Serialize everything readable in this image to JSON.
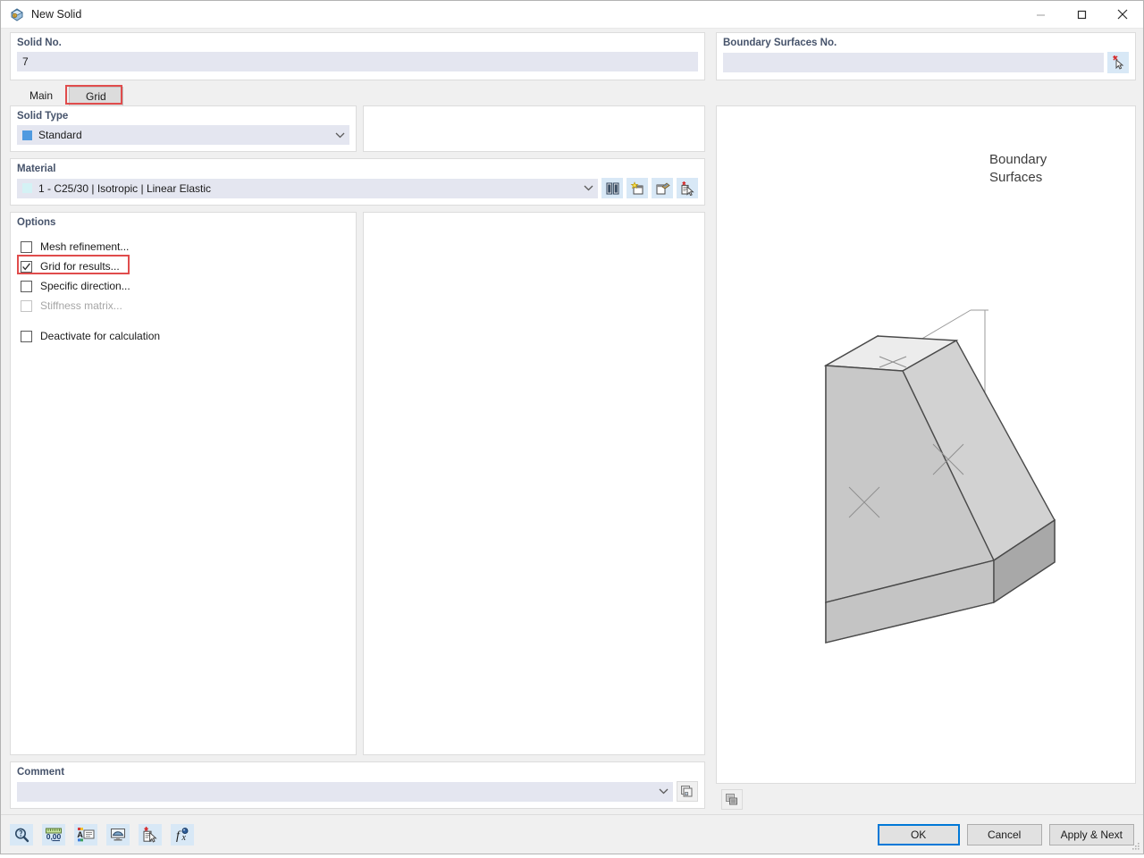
{
  "window": {
    "title": "New Solid",
    "icon": "solid-icon",
    "minimize_label": "Minimize",
    "maximize_label": "Maximize",
    "close_label": "Close"
  },
  "solid_no": {
    "label": "Solid No.",
    "value": "7",
    "placeholder": ""
  },
  "boundary_surfaces": {
    "label": "Boundary Surfaces No.",
    "value": "",
    "placeholder": "",
    "pick_button": "select-boundary-surfaces-button"
  },
  "tabs": [
    {
      "id": "main",
      "label": "Main",
      "active": false
    },
    {
      "id": "grid",
      "label": "Grid",
      "active": true
    }
  ],
  "solid_type": {
    "label": "Solid Type",
    "value": "Standard",
    "swatch_color": "#4f9ae0"
  },
  "material": {
    "label": "Material",
    "value": "1 - C25/30 | Isotropic | Linear Elastic",
    "swatch_color": "#d4f2f5",
    "buttons": [
      {
        "id": "library",
        "name": "material-library-button"
      },
      {
        "id": "new",
        "name": "new-material-button"
      },
      {
        "id": "edit",
        "name": "edit-material-button"
      },
      {
        "id": "pick",
        "name": "pick-material-button"
      }
    ]
  },
  "options": {
    "label": "Options",
    "items": [
      {
        "id": "mesh-refinement",
        "label": "Mesh refinement...",
        "checked": false,
        "disabled": false,
        "highlighted": false
      },
      {
        "id": "grid-for-results",
        "label": "Grid for results...",
        "checked": true,
        "disabled": false,
        "highlighted": true
      },
      {
        "id": "specific-direction",
        "label": "Specific direction...",
        "checked": false,
        "disabled": false,
        "highlighted": false
      },
      {
        "id": "stiffness-matrix",
        "label": "Stiffness matrix...",
        "checked": false,
        "disabled": true,
        "highlighted": false
      },
      {
        "id": "deactivate-for-calculation",
        "label": "Deactivate for calculation",
        "checked": false,
        "disabled": false,
        "highlighted": false
      }
    ]
  },
  "comment": {
    "label": "Comment",
    "value": "",
    "placeholder": "",
    "button_name": "comment-templates-button"
  },
  "preview": {
    "annotation": "Boundary Surfaces",
    "annotation_line1": "Boundary",
    "annotation_line2": "Surfaces",
    "view_button": "render-options-button"
  },
  "footer": {
    "tools": [
      {
        "id": "zoom",
        "name": "magnifier-icon"
      },
      {
        "id": "units",
        "name": "units-decimal-places-icon"
      },
      {
        "id": "display-props",
        "name": "display-properties-icon"
      },
      {
        "id": "visibility",
        "name": "visibility-icon"
      },
      {
        "id": "detail",
        "name": "detail-settings-icon"
      },
      {
        "id": "formula",
        "name": "formula-icon"
      }
    ],
    "buttons": [
      {
        "id": "ok",
        "label": "OK",
        "primary": true
      },
      {
        "id": "cancel",
        "label": "Cancel",
        "primary": false
      },
      {
        "id": "apply-next",
        "label": "Apply & Next",
        "primary": false
      }
    ]
  },
  "colors": {
    "accent": "#0078d7",
    "group_title": "#46536b",
    "field_bg": "#e4e6f0",
    "highlight_red": "#e04c4c",
    "toolbtn_bg": "#d8e8f6"
  }
}
